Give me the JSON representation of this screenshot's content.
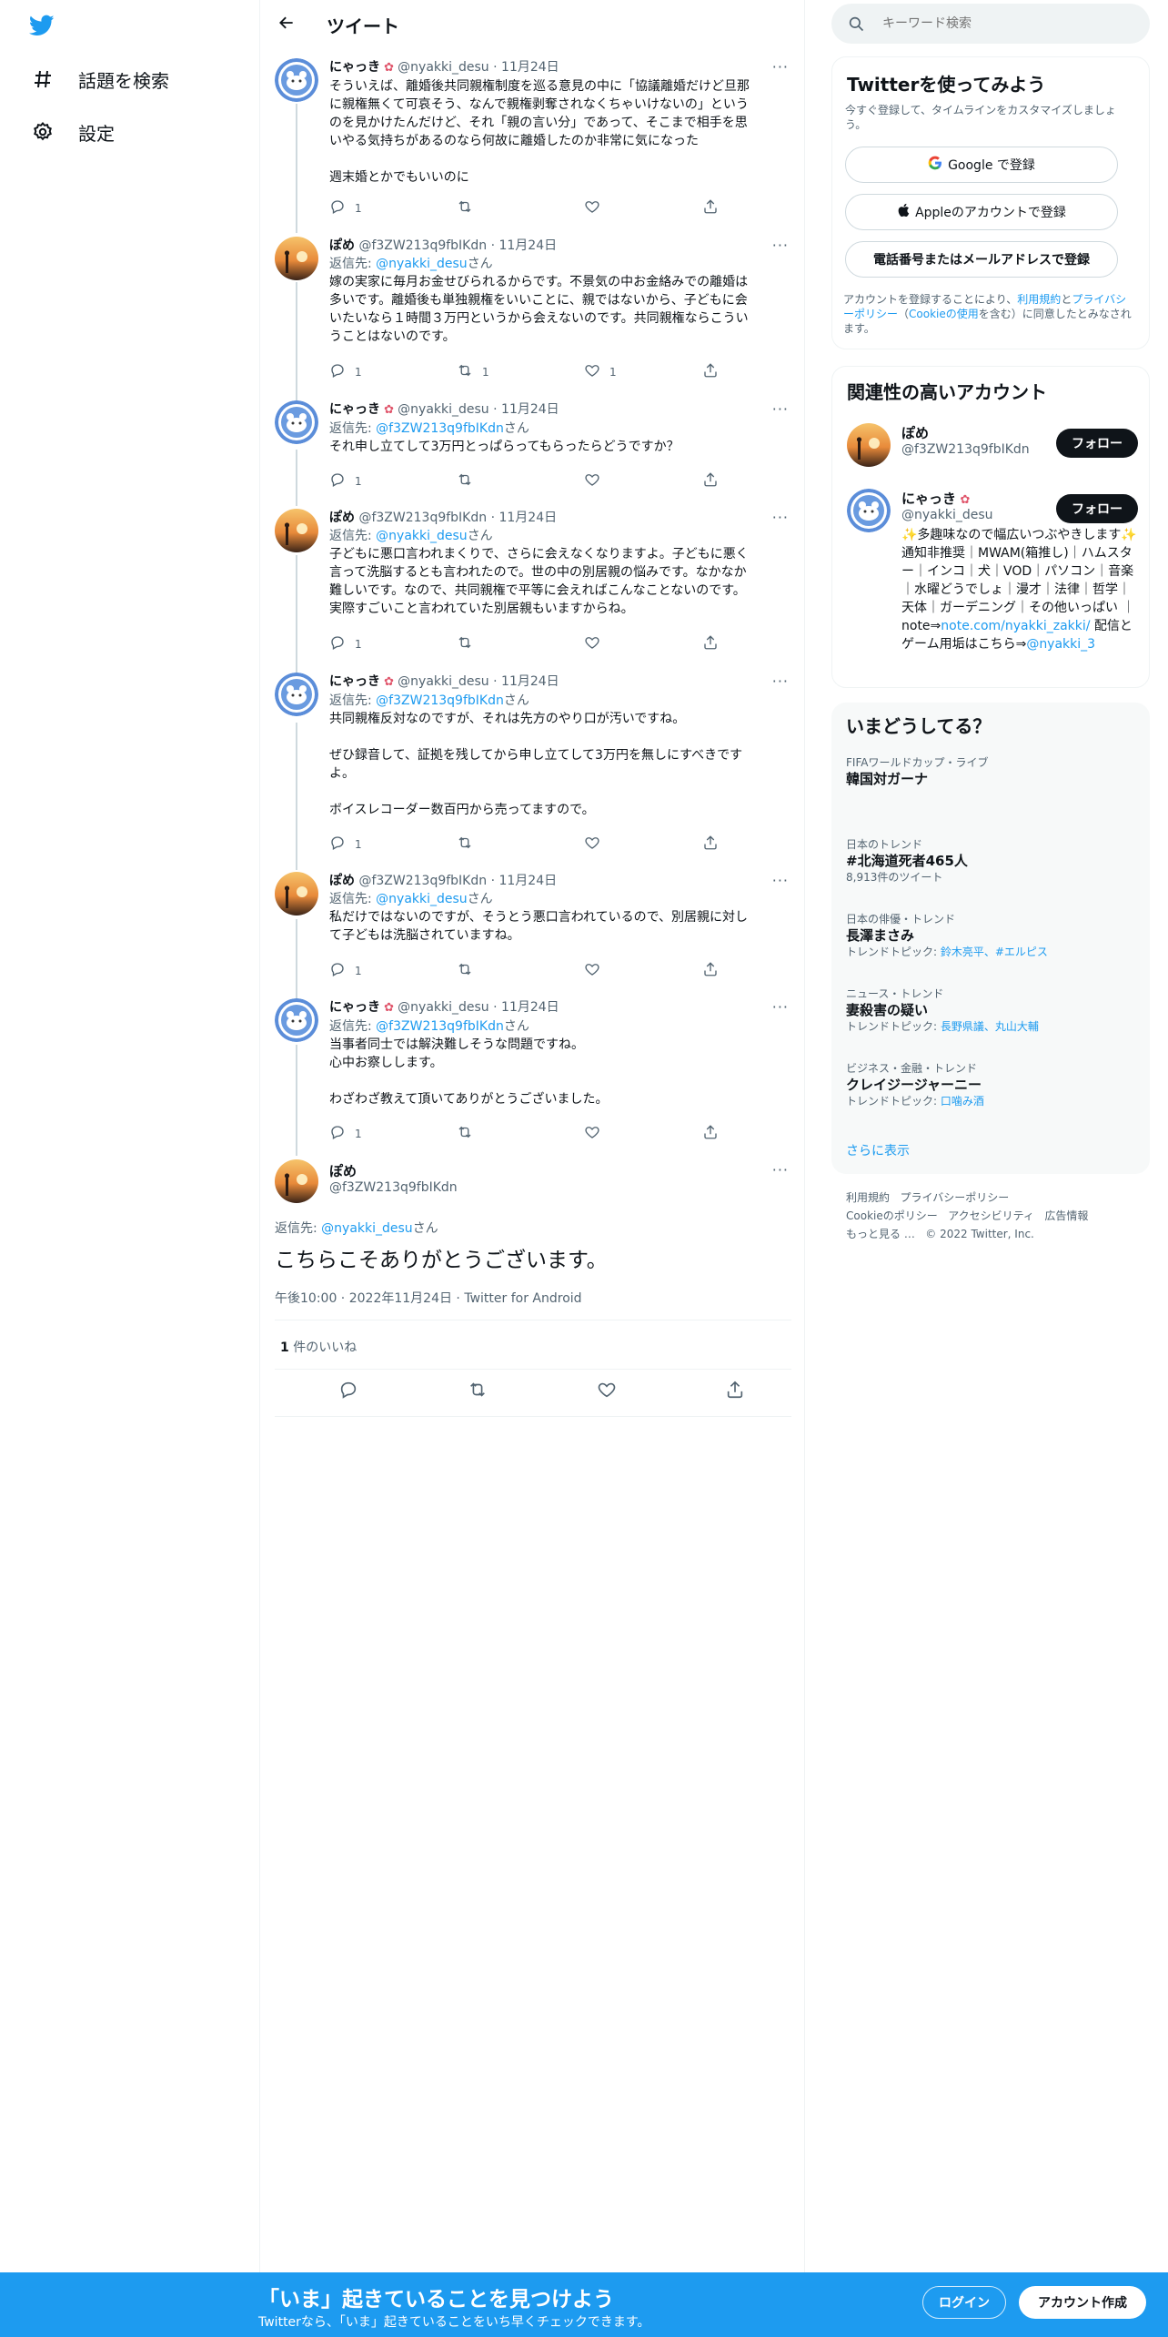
{
  "colors": {
    "accent": "#1d9bf0",
    "text": "#0f1419",
    "muted": "#536471"
  },
  "nav": {
    "explore_label": "話題を検索",
    "settings_label": "設定"
  },
  "header": {
    "title": "ツイート"
  },
  "tweets": [
    {
      "name": "にゃっき",
      "handle": "@nyakki_desu",
      "date": "11月24日",
      "reply_prefix": "",
      "reply_to": "",
      "reply_suffix": "",
      "text": "そういえば、離婚後共同親権制度を巡る意見の中に「協議離婚だけど旦那\nに親権無くて可哀そう、なんで親権剥奪されなくちゃいけないの」という\nのを見かけたんだけど、それ「親の言い分」であって、そこまで相手を思\nいやる気持ちがあるのなら何故に離婚したのか非常に気になった\n\n週末婚とかでもいいのに",
      "reply_count": "1",
      "retweet_count": "",
      "like_count": ""
    },
    {
      "name": "ぽめ",
      "handle": "@f3ZW213q9fbIKdn",
      "date": "11月24日",
      "reply_prefix": "返信先: ",
      "reply_to": "@nyakki_desu",
      "reply_suffix": "さん",
      "text": "嫁の実家に毎月お金せびられるからです。不景気の中お金絡みでの離婚は\n多いです。離婚後も単独親権をいいことに、親ではないから、子どもに会\nいたいなら１時間３万円というから会えないのです。共同親権ならこうい\nうことはないのです。",
      "reply_count": "1",
      "retweet_count": "1",
      "like_count": "1"
    },
    {
      "name": "にゃっき",
      "handle": "@nyakki_desu",
      "date": "11月24日",
      "reply_prefix": "返信先: ",
      "reply_to": "@f3ZW213q9fbIKdn",
      "reply_suffix": "さん",
      "text": "それ申し立てして3万円とっぱらってもらったらどうですか？",
      "reply_count": "1",
      "retweet_count": "",
      "like_count": ""
    },
    {
      "name": "ぽめ",
      "handle": "@f3ZW213q9fbIKdn",
      "date": "11月24日",
      "reply_prefix": "返信先: ",
      "reply_to": "@nyakki_desu",
      "reply_suffix": "さん",
      "text": "子どもに悪口言われまくりで、さらに会えなくなりますよ。子どもに悪く\n言って洗脳するとも言われたので。世の中の別居親の悩みです。なかなか\n難しいです。なので、共同親権で平等に会えればこんなことないのです。\n実際すごいこと言われていた別居親もいますからね。",
      "reply_count": "1",
      "retweet_count": "",
      "like_count": ""
    },
    {
      "name": "にゃっき",
      "handle": "@nyakki_desu",
      "date": "11月24日",
      "reply_prefix": "返信先: ",
      "reply_to": "@f3ZW213q9fbIKdn",
      "reply_suffix": "さん",
      "text": "共同親権反対なのですが、それは先方のやり口が汚いですね。\n\nぜひ録音して、証拠を残してから申し立てして3万円を無しにすべきです\nよ。\n\nボイスレコーダー数百円から売ってますので。",
      "reply_count": "1",
      "retweet_count": "",
      "like_count": ""
    },
    {
      "name": "ぽめ",
      "handle": "@f3ZW213q9fbIKdn",
      "date": "11月24日",
      "reply_prefix": "返信先: ",
      "reply_to": "@nyakki_desu",
      "reply_suffix": "さん",
      "text": "私だけではないのですが、そうとう悪口言われているので、別居親に対し\nて子どもは洗脳されていますね。",
      "reply_count": "1",
      "retweet_count": "",
      "like_count": ""
    },
    {
      "name": "にゃっき",
      "handle": "@nyakki_desu",
      "date": "11月24日",
      "reply_prefix": "返信先: ",
      "reply_to": "@f3ZW213q9fbIKdn",
      "reply_suffix": "さん",
      "text": "当事者同士では解決難しそうな問題ですね。\n心中お察しします。\n\nわざわざ教えて頂いてありがとうございました。",
      "reply_count": "1",
      "retweet_count": "",
      "like_count": ""
    }
  ],
  "focused": {
    "name": "ぽめ",
    "handle": "@f3ZW213q9fbIKdn",
    "reply_prefix": "返信先: ",
    "reply_to": "@nyakki_desu",
    "reply_suffix": "さん",
    "text": "こちらこそありがとうございます。",
    "time": "午後10:00",
    "date": "2022年11月24日",
    "source": "Twitter for Android",
    "like_count": "1",
    "like_label": "件のいいね"
  },
  "search": {
    "placeholder": "キーワード検索"
  },
  "signup_card": {
    "title": "Twitterを使ってみよう",
    "subtitle": "今すぐ登録して、タイムラインをカスタマイズしましょう。",
    "google_label": "Google で登録",
    "apple_label": "Appleのアカウントで登録",
    "phone_label": "電話番号またはメールアドレスで登録",
    "terms_prefix": "アカウントを登録することにより、",
    "terms_link": "利用規約",
    "terms_and": "と",
    "privacy_link": "プライバシーポリシー",
    "paren_open": "（",
    "cookie_link": "Cookieの使用",
    "terms_suffix": "を含む）に同意したとみなされます。"
  },
  "related": {
    "title": "関連性の高いアカウント",
    "follow_label": "フォロー",
    "accounts": [
      {
        "name": "ぽめ",
        "handle": "@f3ZW213q9fbIKdn"
      },
      {
        "name": "にゃっき",
        "handle": "@nyakki_desu"
      }
    ],
    "bio_part1": "✨多趣味なので幅広いつぶやきします✨通知非推奨｜MWAM(箱推し)｜ハムスター｜インコ｜犬｜VOD｜パソコン｜音楽｜水曜どうでしょ｜漫才｜法律｜哲学｜天体｜ガーデニング｜その他いっぱい ｜note⇒",
    "bio_link1": "note.com/nyakki_zakki/",
    "bio_part2": " 配信とゲーム用垢はこちら⇒",
    "bio_link2": "@nyakki_3"
  },
  "trends": {
    "title": "いまどうしてる？",
    "items": [
      {
        "category": "FIFAワールドカップ・ライブ",
        "name": "韓国対ガーナ",
        "sub_prefix": "",
        "sub_links": ""
      },
      {
        "category": "日本のトレンド",
        "name": "#北海道死者465人",
        "sub_prefix": "8,913件のツイート",
        "sub_links": ""
      },
      {
        "category": "日本の俳優・トレンド",
        "name": "長澤まさみ",
        "sub_prefix": "トレンドトピック: ",
        "sub_links": "鈴木亮平、#エルピス"
      },
      {
        "category": "ニュース・トレンド",
        "name": "妻殺害の疑い",
        "sub_prefix": "トレンドトピック: ",
        "sub_links": "長野県議、丸山大輔"
      },
      {
        "category": "ビジネス・金融・トレンド",
        "name": "クレイジージャーニー",
        "sub_prefix": "トレンドトピック: ",
        "sub_links": "口噛み酒"
      }
    ],
    "show_more": "さらに表示"
  },
  "footer": {
    "terms": "利用規約",
    "privacy": "プライバシーポリシー",
    "cookie": "Cookieのポリシー",
    "accessibility": "アクセシビリティ",
    "ads": "広告情報",
    "more": "もっと見る …",
    "copyright": "© 2022 Twitter, Inc."
  },
  "banner": {
    "title": "「いま」起きていることを見つけよう",
    "subtitle": "Twitterなら、「いま」起きていることをいち早くチェックできます。",
    "login": "ログイン",
    "signup": "アカウント作成"
  }
}
